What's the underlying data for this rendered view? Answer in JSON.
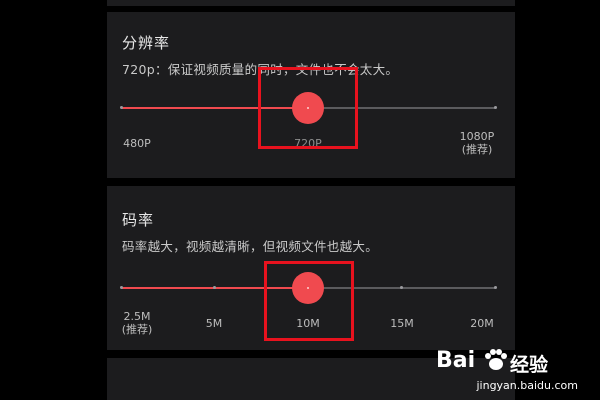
{
  "resolution": {
    "title": "分辨率",
    "description": "720p：保证视频质量的同时，文件也不会太大。",
    "selected_fraction": 0.5,
    "labels": [
      {
        "line1": "480P",
        "line2": ""
      },
      {
        "line1": "720P",
        "line2": ""
      },
      {
        "line1": "1080P",
        "line2": "(推荐)"
      }
    ]
  },
  "bitrate": {
    "title": "码率",
    "description": "码率越大，视频越清晰，但视频文件也越大。",
    "selected_fraction": 0.5,
    "labels": [
      {
        "line1": "2.5M",
        "line2": "(推荐)"
      },
      {
        "line1": "5M",
        "line2": ""
      },
      {
        "line1": "10M",
        "line2": ""
      },
      {
        "line1": "15M",
        "line2": ""
      },
      {
        "line1": "20M",
        "line2": ""
      }
    ]
  },
  "colors": {
    "accent": "#f04a4f",
    "highlight": "#e8121e",
    "panel": "#1c1c1e"
  },
  "watermark": {
    "brand": "Bai",
    "brand_suffix": "经验",
    "url": "jingyan.baidu.com",
    "icon": "paw-icon"
  }
}
